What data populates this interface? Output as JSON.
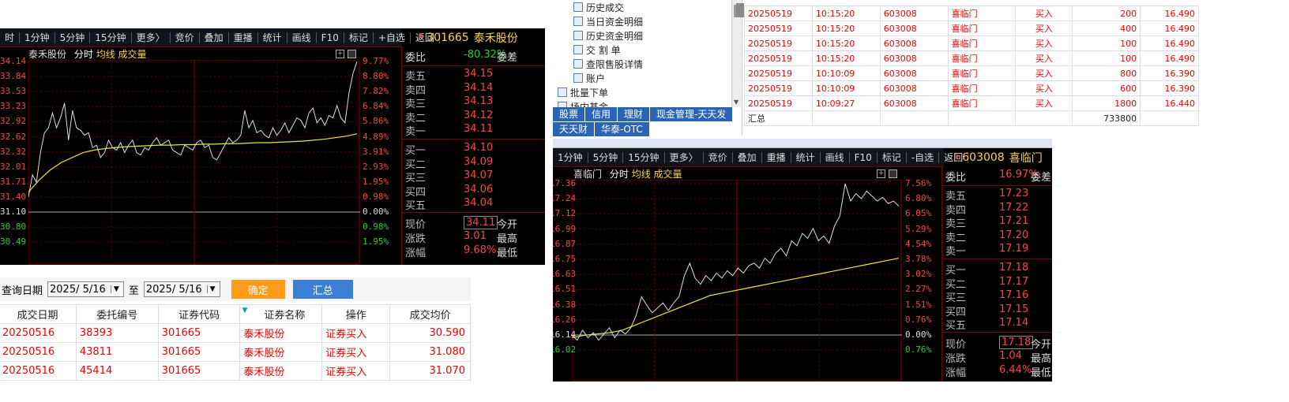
{
  "left": {
    "toolbar": [
      "时",
      "1分钟",
      "5分钟",
      "15分钟",
      "更多〉",
      "竞价",
      "叠加",
      "重播",
      "统计",
      "画线",
      "F10",
      "标记",
      "+自选",
      "返回"
    ],
    "stock_badge": "R",
    "stock_code": "301665",
    "stock_name": "泰禾股份",
    "chart_title_name": "泰禾股份",
    "chart_title_items": [
      "分时",
      "均线",
      "成交量"
    ],
    "price_labels": [
      "34.14",
      "33.84",
      "33.53",
      "33.23",
      "32.92",
      "32.62",
      "32.32",
      "32.01",
      "31.71",
      "31.40",
      "31.10",
      "30.80",
      "30.49"
    ],
    "pct_labels": [
      "9.77%",
      "8.80%",
      "7.82%",
      "6.84%",
      "5.86%",
      "4.89%",
      "3.91%",
      "2.93%",
      "1.95%",
      "0.98%",
      "0.00%",
      "0.98%",
      "1.95%"
    ],
    "weibi_label": "委比",
    "weibi_value": "-80.32%",
    "weicha_label": "委差",
    "asks": [
      {
        "label": "卖五",
        "price": "34.15"
      },
      {
        "label": "卖四",
        "price": "34.14"
      },
      {
        "label": "卖三",
        "price": "34.13"
      },
      {
        "label": "卖二",
        "price": "34.12"
      },
      {
        "label": "卖一",
        "price": "34.11"
      }
    ],
    "bids": [
      {
        "label": "买一",
        "price": "34.10"
      },
      {
        "label": "买二",
        "price": "34.09"
      },
      {
        "label": "买三",
        "price": "34.07"
      },
      {
        "label": "买四",
        "price": "34.06"
      },
      {
        "label": "买五",
        "price": "34.04"
      }
    ],
    "stats": [
      {
        "label": "现价",
        "value": "34.11",
        "right": "今开"
      },
      {
        "label": "涨跌",
        "value": "3.01",
        "right": "最高"
      },
      {
        "label": "涨幅",
        "value": "9.68%",
        "right": "最低"
      }
    ],
    "series_price": [
      31.4,
      31.85,
      31.7,
      32.3,
      32.7,
      32.8,
      33.1,
      32.8,
      33.0,
      33.3,
      32.55,
      33.15,
      32.8,
      32.75,
      32.65,
      32.7,
      32.4,
      32.45,
      32.2,
      32.3,
      32.55,
      32.4,
      32.35,
      32.5,
      32.3,
      32.45,
      32.55,
      32.3,
      32.25,
      32.4,
      32.35,
      32.5,
      32.6,
      32.45,
      32.5,
      32.55,
      32.35,
      32.3,
      32.25,
      32.45,
      32.4,
      32.35,
      32.5,
      32.55,
      32.4,
      32.45,
      32.2,
      32.15,
      32.3,
      32.45,
      32.6,
      32.5,
      32.55,
      32.65,
      33.15,
      32.8,
      32.95,
      32.7,
      32.75,
      32.65,
      32.6,
      32.8,
      32.65,
      32.75,
      32.9,
      32.7,
      32.85,
      33.0,
      32.95,
      32.8,
      33.1,
      33.2,
      32.9,
      33.0,
      32.85,
      33.05,
      33.0,
      33.25,
      33.0,
      32.9,
      33.5,
      33.9,
      34.14
    ],
    "series_avg": [
      31.5,
      31.75,
      31.95,
      32.1,
      32.2,
      32.3,
      32.35,
      32.38,
      32.4,
      32.42,
      32.43,
      32.44,
      32.45,
      32.45,
      32.46,
      32.46,
      32.47,
      32.47,
      32.48,
      32.48,
      32.49,
      32.5,
      32.5,
      32.51,
      32.52,
      32.53,
      32.55,
      32.57,
      32.6,
      32.63,
      32.68
    ]
  },
  "query": {
    "date_label": "查询日期",
    "from_date": "2025/ 5/16",
    "to_label": "至",
    "to_date": "2025/ 5/16",
    "confirm": "确定",
    "summary": "汇总"
  },
  "trades": {
    "headers": [
      "成交日期",
      "委托编号",
      "证券代码",
      "证券名称",
      "操作",
      "成交均价"
    ],
    "rows": [
      [
        "20250516",
        "38393",
        "301665",
        "泰禾股份",
        "证券买入",
        "30.590"
      ],
      [
        "20250516",
        "43811",
        "301665",
        "泰禾股份",
        "证券买入",
        "31.080"
      ],
      [
        "20250516",
        "45414",
        "301665",
        "泰禾股份",
        "证券买入",
        "31.070"
      ]
    ]
  },
  "tree": {
    "items": [
      "历史成交",
      "当日资金明细",
      "历史资金明细",
      "交 割 单",
      "查限售股详情",
      "账户",
      "批量下单",
      "场内基金"
    ]
  },
  "tabs_row1": [
    "股票",
    "信用",
    "理财",
    "现金管理-天天发"
  ],
  "tabs_row2": [
    "天天财",
    "华泰-OTC"
  ],
  "deals": {
    "rows": [
      [
        "20250519",
        "10:15:20",
        "603008",
        "喜临门",
        "买入",
        "200",
        "16.490"
      ],
      [
        "20250519",
        "10:15:20",
        "603008",
        "喜临门",
        "买入",
        "400",
        "16.490"
      ],
      [
        "20250519",
        "10:15:20",
        "603008",
        "喜临门",
        "买入",
        "100",
        "16.490"
      ],
      [
        "20250519",
        "10:15:20",
        "603008",
        "喜临门",
        "买入",
        "100",
        "16.490"
      ],
      [
        "20250519",
        "10:10:09",
        "603008",
        "喜临门",
        "买入",
        "800",
        "16.390"
      ],
      [
        "20250519",
        "10:10:09",
        "603008",
        "喜临门",
        "买入",
        "600",
        "16.390"
      ],
      [
        "20250519",
        "10:09:27",
        "603008",
        "喜临门",
        "买入",
        "1800",
        "16.440"
      ]
    ],
    "total_label": "汇总",
    "total_value": "733800"
  },
  "right": {
    "toolbar": [
      "1分钟",
      "5分钟",
      "15分钟",
      "更多〉",
      "竞价",
      "叠加",
      "重播",
      "统计",
      "画线",
      "F10",
      "标记",
      "-自选",
      "返回"
    ],
    "stock_badge": "R",
    "stock_code": "603008",
    "stock_name": "喜临门",
    "chart_title_name": "喜临门",
    "chart_title_items": [
      "分时",
      "均线",
      "成交量"
    ],
    "price_labels": [
      "17.36",
      "17.24",
      "17.12",
      "16.99",
      "16.87",
      "16.75",
      "16.63",
      "16.51",
      "16.38",
      "16.26",
      "16.14",
      "16.02"
    ],
    "pct_labels": [
      "7.56%",
      "6.80%",
      "6.05%",
      "5.29%",
      "4.54%",
      "3.78%",
      "3.02%",
      "2.27%",
      "1.51%",
      "0.76%",
      "0.00%",
      "0.76%"
    ],
    "weibi_label": "委比",
    "weibi_value": "16.97%",
    "weicha_label": "委差",
    "asks": [
      {
        "label": "卖五",
        "price": "17.23"
      },
      {
        "label": "卖四",
        "price": "17.22"
      },
      {
        "label": "卖三",
        "price": "17.21"
      },
      {
        "label": "卖二",
        "price": "17.20"
      },
      {
        "label": "卖一",
        "price": "17.19"
      }
    ],
    "bids": [
      {
        "label": "买一",
        "price": "17.18"
      },
      {
        "label": "买二",
        "price": "17.17"
      },
      {
        "label": "买三",
        "price": "17.16"
      },
      {
        "label": "买四",
        "price": "17.15"
      },
      {
        "label": "买五",
        "price": "17.14"
      }
    ],
    "stats": [
      {
        "label": "现价",
        "value": "17.18",
        "right": "今开"
      },
      {
        "label": "涨跌",
        "value": "1.04",
        "right": "最高"
      },
      {
        "label": "涨幅",
        "value": "6.44%",
        "right": "最低"
      }
    ],
    "series_price": [
      16.14,
      16.1,
      16.18,
      16.12,
      16.16,
      16.1,
      16.15,
      16.2,
      16.12,
      16.18,
      16.15,
      16.2,
      16.3,
      16.45,
      16.38,
      16.32,
      16.36,
      16.4,
      16.34,
      16.4,
      16.45,
      16.62,
      16.72,
      16.6,
      16.55,
      16.62,
      16.58,
      16.64,
      16.6,
      16.66,
      16.62,
      16.68,
      16.64,
      16.7,
      16.72,
      16.68,
      16.76,
      16.72,
      16.8,
      16.84,
      16.78,
      16.9,
      16.86,
      16.96,
      16.92,
      17.0,
      16.9,
      16.94,
      16.88,
      17.02,
      17.1,
      17.36,
      17.22,
      17.28,
      17.24,
      17.3,
      17.26,
      17.22,
      17.25,
      17.2,
      17.22,
      17.18
    ],
    "series_avg": [
      16.12,
      16.14,
      16.15,
      16.16,
      16.18,
      16.22,
      16.26,
      16.3,
      16.34,
      16.38,
      16.42,
      16.46,
      16.48,
      16.5,
      16.52,
      16.54,
      16.56,
      16.58,
      16.6,
      16.62,
      16.64,
      16.66,
      16.68,
      16.7,
      16.72,
      16.74,
      16.76
    ]
  }
}
